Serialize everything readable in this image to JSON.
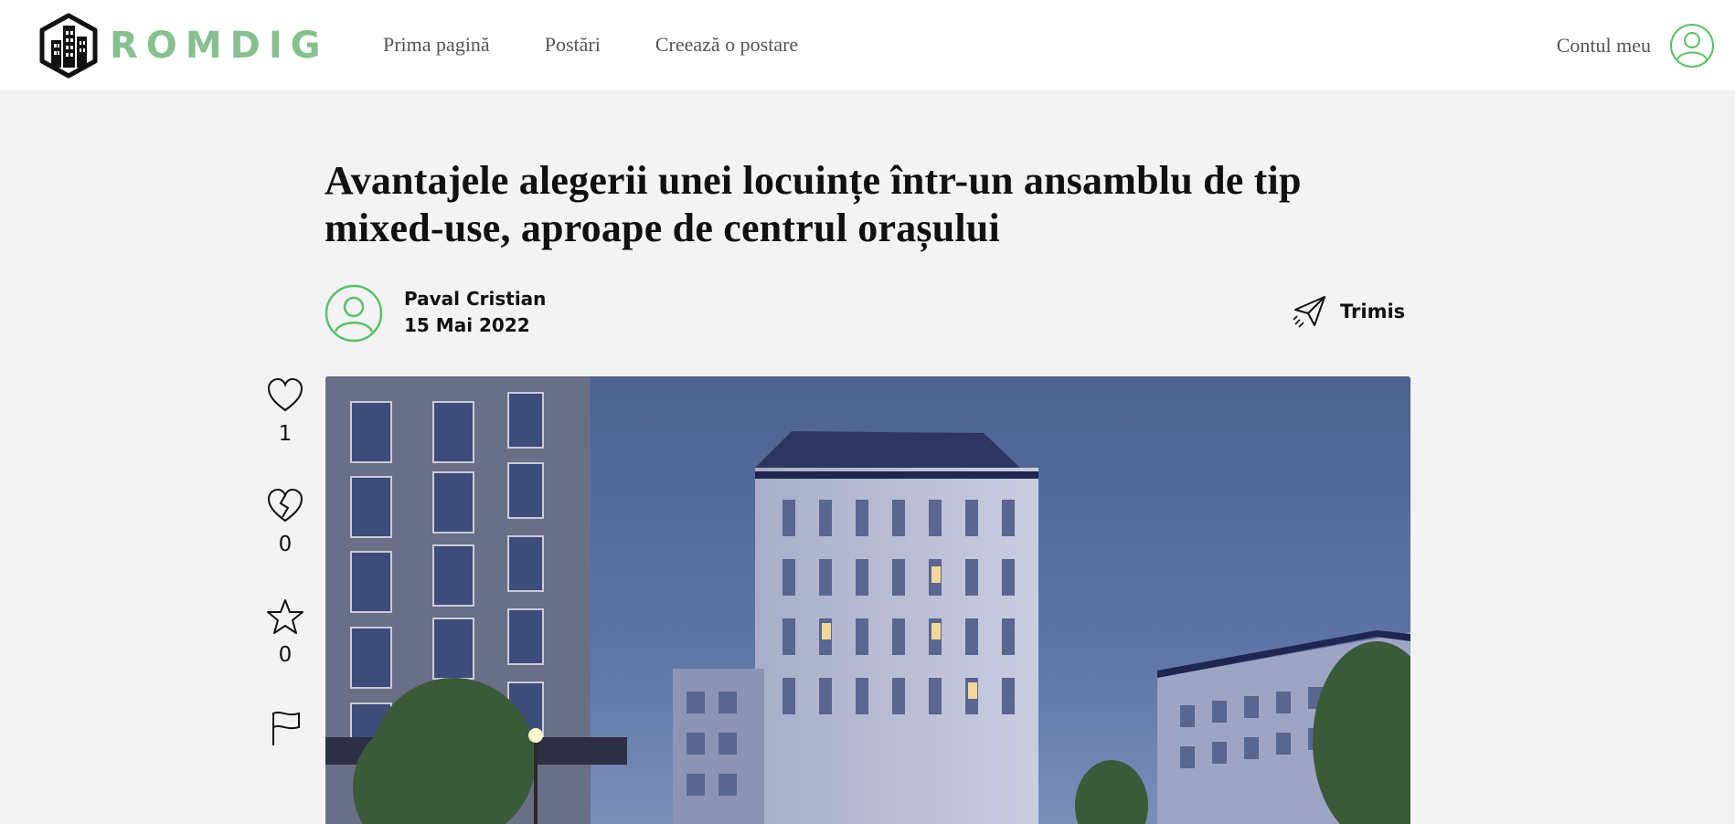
{
  "header": {
    "logo_text": "ROMDIG",
    "nav": [
      "Prima pagină",
      "Postări",
      "Creează o postare"
    ],
    "account_label": "Contul meu",
    "brand_color": "#86c08f",
    "icons": {
      "logo": "building-logo-icon",
      "account": "user-circle-icon"
    }
  },
  "post": {
    "title": "Avantajele alegerii unei locuințe într-un ansamblu de tip mixed-use, aproape de centrul orașului",
    "author": "Paval Cristian",
    "date": "15 Mai 2022",
    "send_label": "Trimis",
    "image_description_icon": "building-photo"
  },
  "reactions": {
    "likes": "1",
    "dislikes": "0",
    "favorites": "0",
    "icons": [
      "heart-icon",
      "broken-heart-icon",
      "star-icon",
      "flag-icon"
    ]
  }
}
